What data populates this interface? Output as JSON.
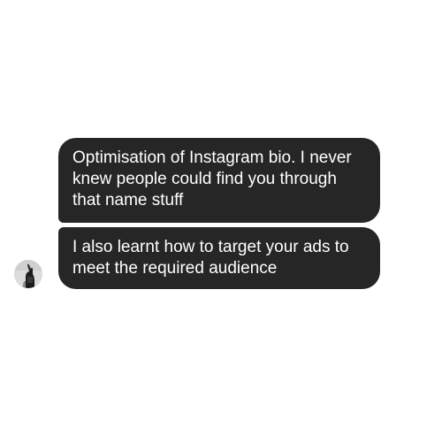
{
  "messages": [
    {
      "text": "Optimisation of Instagram bio. I never\nknew people could find you through\nthat name stuff"
    },
    {
      "text": "I also learnt how to target your ads to\nmeet the required audience"
    }
  ],
  "colors": {
    "bubble_background": "#262626",
    "bubble_text": "#ffffff",
    "page_background": "#ffffff"
  },
  "sender": {
    "avatar_icon": "user-avatar-photo"
  }
}
